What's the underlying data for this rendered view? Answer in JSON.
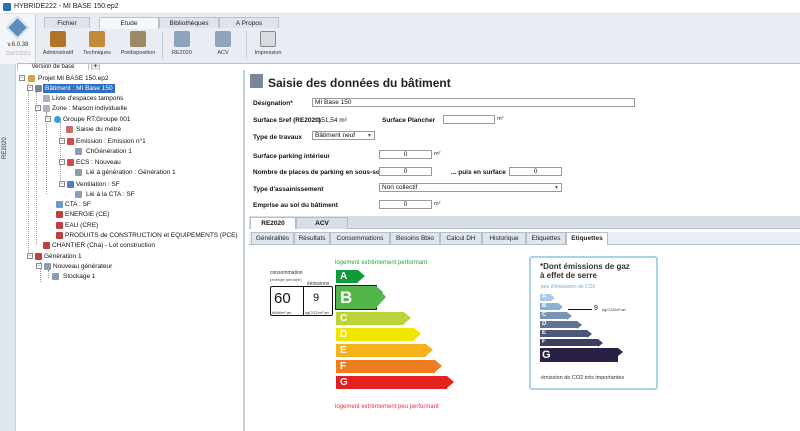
{
  "titlebar": {
    "title": "HYBRIDE222 - MI BASE 150.ep2"
  },
  "app": {
    "version": "v.6.0.38",
    "date": "15/07/2021"
  },
  "ribbon": {
    "tabs": [
      {
        "label": "Fichier"
      },
      {
        "label": "Etude"
      },
      {
        "label": "Bibliothèques"
      },
      {
        "label": "A Propos"
      }
    ],
    "active_tab": "Etude",
    "buttons": [
      {
        "label": "Administratif"
      },
      {
        "label": "Techniques"
      },
      {
        "label": "Prédisposition"
      },
      {
        "label": "RE2020"
      },
      {
        "label": "ACV"
      },
      {
        "label": "Impression"
      }
    ]
  },
  "left_strip": {
    "label": "RE2020"
  },
  "tree": {
    "tab": "Version de base",
    "add": "+",
    "nodes": [
      {
        "label": "Projet MI BASE 150.ep2"
      },
      {
        "label": "Bâtiment : MI Base 150"
      },
      {
        "label": "Liste d'espaces tampons"
      },
      {
        "label": "Zone : Maison individuelle"
      },
      {
        "label": "Groupe RT:Groupe 001"
      },
      {
        "label": "Saisie du métré"
      },
      {
        "label": "Emission : Emission n°1"
      },
      {
        "label": "ChGénération 1"
      },
      {
        "label": "ECS : Nouveau"
      },
      {
        "label": "Lié à génération : Génération 1"
      },
      {
        "label": "Ventilation : SF"
      },
      {
        "label": "Lié à la CTA : SF"
      },
      {
        "label": "CTA : SF"
      },
      {
        "label": "ENERGIE (CE)"
      },
      {
        "label": "EAU (CRE)"
      },
      {
        "label": "PRODUITS de CONSTRUCTION et EQUIPEMENTS (PCE)"
      },
      {
        "label": "CHANTIER (Cha) - Lot construction"
      },
      {
        "label": "Génération 1"
      },
      {
        "label": "Nouveau générateur"
      },
      {
        "label": "Stockage 1"
      }
    ]
  },
  "form": {
    "heading": "Saisie des données du bâtiment",
    "designation_label": "Désignation*",
    "designation_value": "MI Base 150",
    "sref_label": "Surface Sref (RE2020)",
    "sref_value": ": 151,54 m²",
    "plancher_label": "Surface Plancher",
    "plancher_value": "",
    "plancher_unit": "m²",
    "travaux_label": "Type de travaux",
    "travaux_value": "Bâtiment neuf",
    "parking_label": "Surface parking intérieur",
    "parking_value": "0",
    "parking_unit": "m²",
    "places_label": "Nombre de places de parking en sous-sol",
    "places_value": "0",
    "places_surface_label": "... puis en surface",
    "places_surface_value": "0",
    "assainissement_label": "Type d'assainissement",
    "assainissement_value": "Non collectif",
    "emprise_label": "Emprise au sol du bâtiment",
    "emprise_value": "0",
    "emprise_unit": "m²"
  },
  "tabs_top": [
    {
      "label": "RE2020"
    },
    {
      "label": "ACV"
    }
  ],
  "tabs_sub": [
    {
      "label": "Généralités"
    },
    {
      "label": "Résultats"
    },
    {
      "label": "Consommations"
    },
    {
      "label": "Besoins Bbio"
    },
    {
      "label": "Calcul DH"
    },
    {
      "label": "Historique"
    },
    {
      "label": "Etiquettes"
    },
    {
      "label": "Etiquettes"
    }
  ],
  "energy_label": {
    "top_text": "logement extrêmement performant",
    "bottom_text": "logement extrêmement peu performant",
    "cons_label": "consommation",
    "cons_sub": "(énergie primaire)",
    "emis_label": "émissions",
    "cons_value": "60",
    "cons_unit": "kWh/m².an",
    "emis_value": "9",
    "emis_unit": "kgCO2/m².an",
    "classes": [
      "A",
      "B",
      "C",
      "D",
      "E",
      "F",
      "G"
    ],
    "current_class": "B",
    "colors": [
      "#109a3c",
      "#54b54a",
      "#bcd43a",
      "#f2e600",
      "#f7b21b",
      "#ef7d1f",
      "#e3221f"
    ]
  },
  "gas_label": {
    "title_line1": "*Dont émissions de gaz",
    "title_line2": "à effet de serre",
    "subtitle": "peu d'émissions de CO2",
    "classes": [
      "A",
      "B",
      "C",
      "D",
      "E",
      "F",
      "G"
    ],
    "value": "9",
    "unit": "kgCO2/m².an",
    "footer": "émission de CO2 très importantes",
    "colors": [
      "#a9cbeb",
      "#8bb0d6",
      "#7893b5",
      "#5f7392",
      "#4e577a",
      "#3e3d62",
      "#2a1f44"
    ]
  }
}
